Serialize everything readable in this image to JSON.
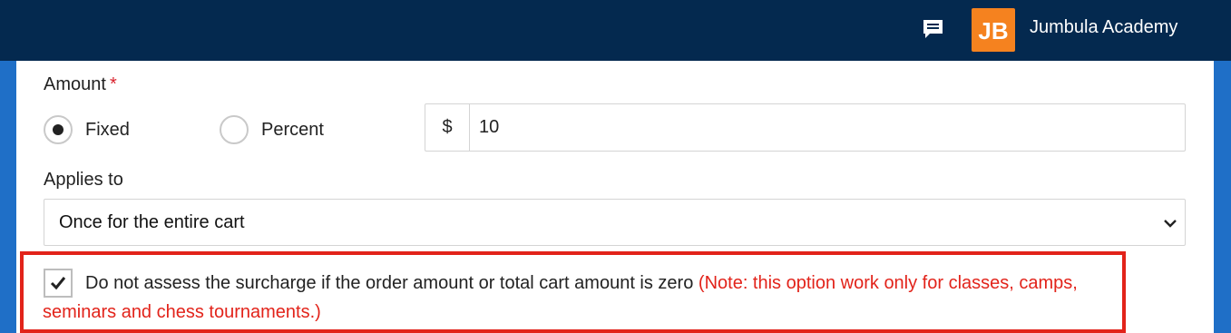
{
  "header": {
    "chat_icon": "chat-icon",
    "logo_text": "JB",
    "brand_name": "Jumbula Academy",
    "colors": {
      "bar": "#04294f",
      "logo": "#f5821f",
      "frame": "#1f6fc7"
    }
  },
  "form": {
    "amount": {
      "label": "Amount",
      "required_mark": "*",
      "options": [
        {
          "label": "Fixed",
          "checked": true
        },
        {
          "label": "Percent",
          "checked": false
        }
      ],
      "currency_symbol": "$",
      "value": "10"
    },
    "applies_to": {
      "label": "Applies to",
      "selected": "Once for the entire cart"
    },
    "zero_amount": {
      "checked": true,
      "text": "Do not assess the surcharge if the order amount or total cart amount is zero",
      "note": "(Note: this option work only for classes, camps, seminars and chess tournaments.)",
      "highlight_color": "#e2231a"
    }
  }
}
